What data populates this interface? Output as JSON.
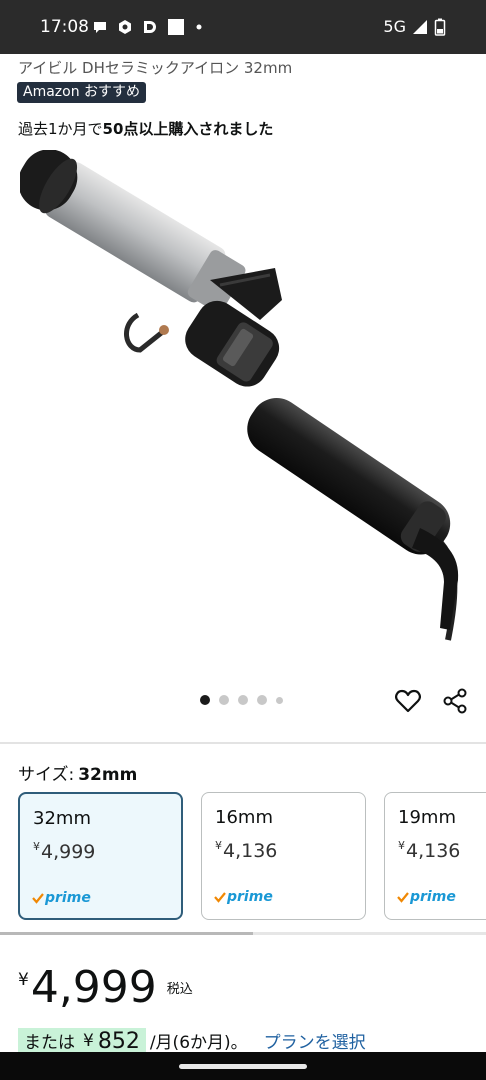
{
  "status_bar": {
    "time": "17:08",
    "network": "5G",
    "icons": [
      "chat-bubble-icon",
      "gear-notification-icon",
      "d-app-icon",
      "square-notification-icon",
      "dot-icon",
      "signal-icon",
      "battery-icon"
    ]
  },
  "product": {
    "title": "アイビル DHセラミックアイロン 32mm",
    "badge": "Amazon おすすめ",
    "bought_prefix": "過去1か月で",
    "bought_bold": "50点以上購入されました"
  },
  "carousel": {
    "page_count": 5,
    "active_index": 0
  },
  "size": {
    "label": "サイズ:",
    "selected": "32mm",
    "options": [
      {
        "size": "32mm",
        "yen": "¥",
        "price": "4,999",
        "prime": "prime",
        "selected": true
      },
      {
        "size": "16mm",
        "yen": "¥",
        "price": "4,136",
        "prime": "prime",
        "selected": false
      },
      {
        "size": "19mm",
        "yen": "¥",
        "price": "4,136",
        "prime": "prime",
        "selected": false
      }
    ]
  },
  "price": {
    "yen": "¥",
    "value": "4,999",
    "tax": "税込"
  },
  "installment": {
    "prefix": "または",
    "yen": "¥",
    "amount": "852",
    "suffix": "/月(6か月)。",
    "link": "プランを選択"
  },
  "colors": {
    "status_bar_bg": "#2b2b2b",
    "badge_bg": "#232f3e",
    "selected_border": "#2f5d7a",
    "selected_bg": "#edf8fc",
    "prime_blue": "#1a98d5",
    "prime_check": "#f08804",
    "link": "#2162a1",
    "installment_highlight": "#c9f2d8"
  }
}
